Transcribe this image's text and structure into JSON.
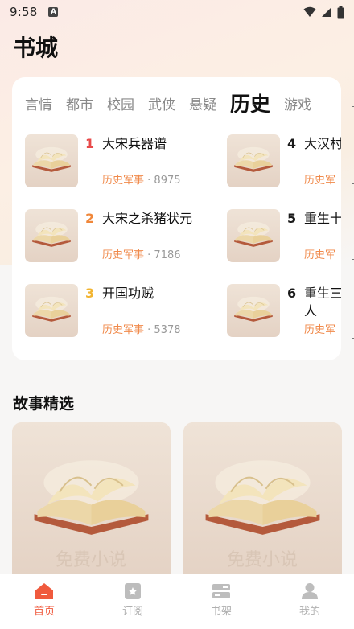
{
  "status_bar": {
    "time": "9:58",
    "app_badge": "A"
  },
  "page_title": "书城",
  "categories": {
    "tabs": [
      {
        "label": "言情",
        "active": false
      },
      {
        "label": "都市",
        "active": false
      },
      {
        "label": "校园",
        "active": false
      },
      {
        "label": "武侠",
        "active": false
      },
      {
        "label": "悬疑",
        "active": false
      },
      {
        "label": "历史",
        "active": true
      },
      {
        "label": "游戏",
        "active": false
      }
    ]
  },
  "ranking": {
    "books": [
      {
        "rank": "1",
        "title": "大宋兵器谱",
        "category": "历史军事",
        "count": "· 8975",
        "rank_color": "#e84a4a"
      },
      {
        "rank": "2",
        "title": "大宋之杀猪状元",
        "category": "历史军事",
        "count": "· 7186",
        "rank_color": "#f0873a"
      },
      {
        "rank": "3",
        "title": "开国功贼",
        "category": "历史军事",
        "count": "· 5378",
        "rank_color": "#f2b430"
      },
      {
        "rank": "4",
        "title": "大汉村",
        "category": "历史军",
        "count": "",
        "rank_color": "#1a1a1a"
      },
      {
        "rank": "5",
        "title": "重生十",
        "category": "历史军",
        "count": "",
        "rank_color": "#1a1a1a"
      },
      {
        "rank": "6",
        "title": "重生三",
        "title_line2": "人",
        "category": "历史军",
        "count": "",
        "rank_color": "#1a1a1a"
      }
    ],
    "cover_watermark": "免费小说"
  },
  "stories": {
    "title": "故事精选",
    "cards": [
      {
        "watermark": "免费小说"
      },
      {
        "watermark": "免费小说"
      }
    ]
  },
  "tabbar": {
    "items": [
      {
        "label": "首页",
        "icon": "home-icon",
        "active": true
      },
      {
        "label": "订阅",
        "icon": "bookmark-icon",
        "active": false
      },
      {
        "label": "书架",
        "icon": "bookshelf-icon",
        "active": false
      },
      {
        "label": "我的",
        "icon": "user-icon",
        "active": false
      }
    ]
  },
  "colors": {
    "accent": "#f05a3d",
    "category_text": "#f08a4b",
    "inactive": "#b0b0b0"
  }
}
